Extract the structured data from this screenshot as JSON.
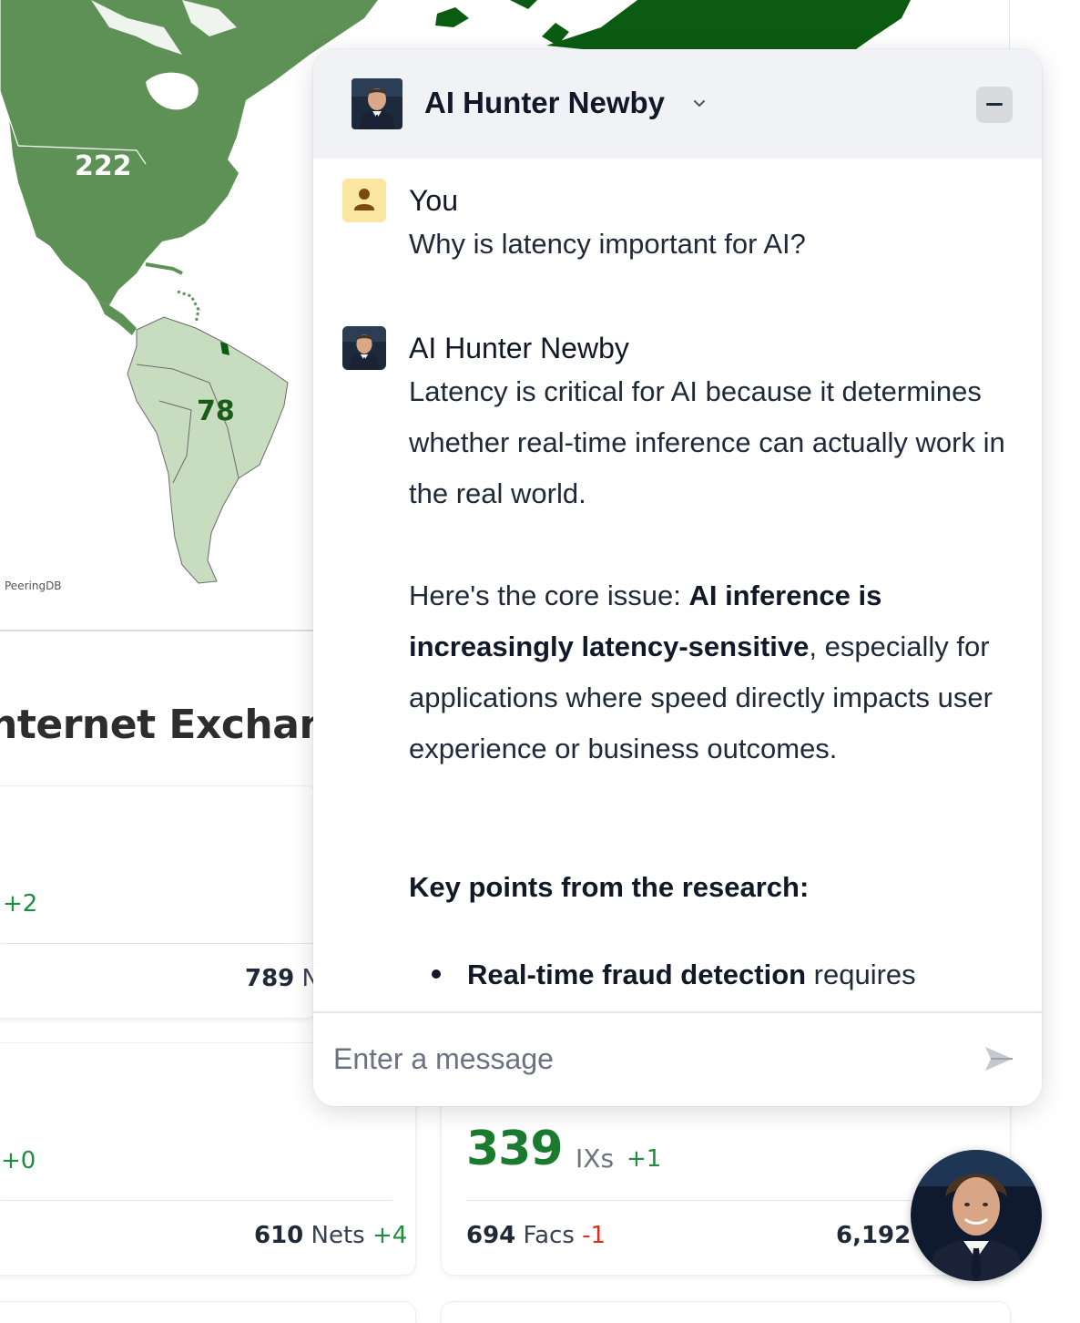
{
  "map": {
    "north_america_count": "222",
    "south_america_count": "78",
    "credit": "PeeringDB",
    "colors": {
      "dark_region": "#0b5c12",
      "medium_region": "#5e9155",
      "light_region": "#c8dcbf"
    }
  },
  "section": {
    "title": "nternet Exchang"
  },
  "cards": {
    "card1": {
      "delta": "+2",
      "nets_value": "789",
      "nets_suffix": "N"
    },
    "card2": {
      "delta": "+0",
      "nets_value": "610",
      "nets_label": "Nets",
      "nets_delta": "+4"
    },
    "card3": {
      "big_value": "339",
      "big_label": "IXs",
      "big_delta": "+1",
      "facs_value": "694",
      "facs_label": "Facs",
      "facs_delta": "-1",
      "other_value": "6,192"
    }
  },
  "chat": {
    "title": "AI Hunter Newby",
    "minimize_icon": "minus-icon",
    "messages": [
      {
        "sender": "You",
        "text": "Why is latency important for AI?"
      },
      {
        "sender": "AI Hunter Newby",
        "p1": "Latency is critical for AI because it determines whether real-time inference can actually work in the real world.",
        "p2_lead": "Here's the core issue: ",
        "p2_bold": "AI inference is increasingly latency-sensitive",
        "p2_rest": ", especially for applications where speed directly impacts user experience or business outcomes.",
        "heading": "Key points from the research:",
        "bullet1_bold": "Real-time fraud detection",
        "bullet1_rest": " requires"
      }
    ],
    "input_placeholder": "Enter a message",
    "send_icon": "send-icon"
  },
  "colors": {
    "accent_green": "#1a7a2e",
    "delta_green": "#1e8e3e",
    "delta_red": "#d93025"
  }
}
